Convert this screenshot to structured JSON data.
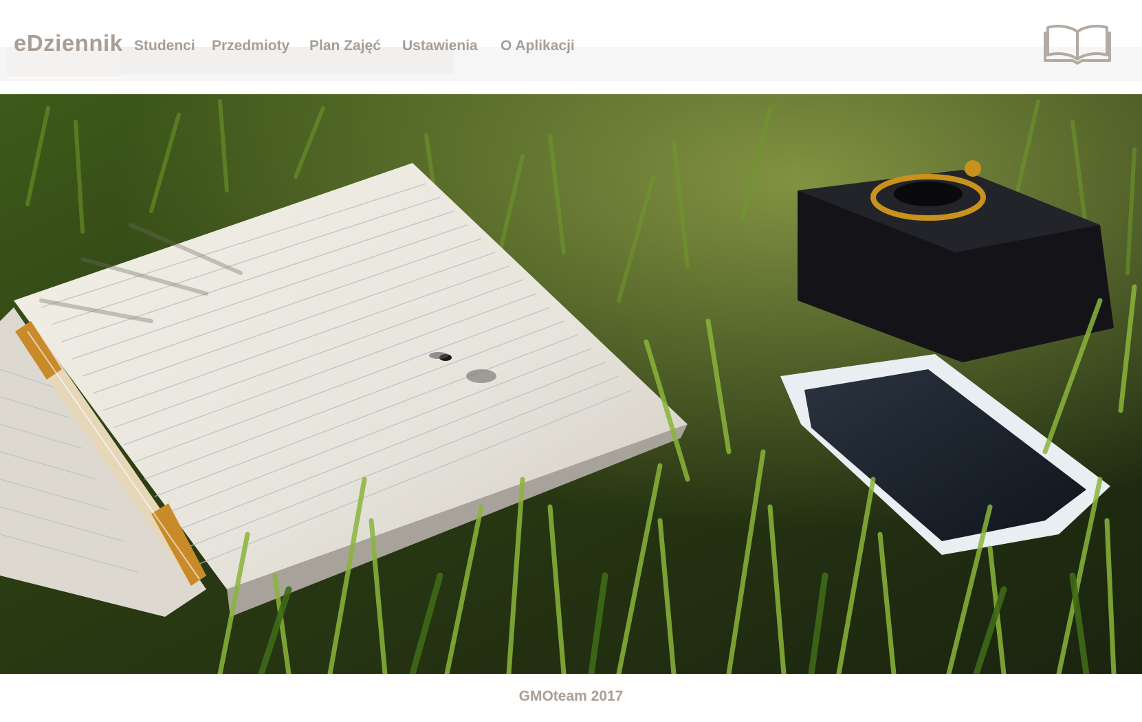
{
  "navbar": {
    "brand": "eDziennik",
    "links": [
      {
        "label": "Studenci"
      },
      {
        "label": "Przedmioty"
      },
      {
        "label": "Plan Zajęć"
      },
      {
        "label": "Ustawienia"
      },
      {
        "label": "O Aplikacji"
      }
    ],
    "logo_icon": "open-book-icon"
  },
  "hero": {
    "image": "photo of an open lined notebook with a fly and a pen, a camera and a smartphone lying in green grass"
  },
  "footer": {
    "text": "GMOteam 2017"
  },
  "colors": {
    "text_accent": "#a89e96",
    "nav_strip": "#f7f6f6",
    "grass_dark": "#1f2a14",
    "grass_light": "#6f9a2a"
  }
}
